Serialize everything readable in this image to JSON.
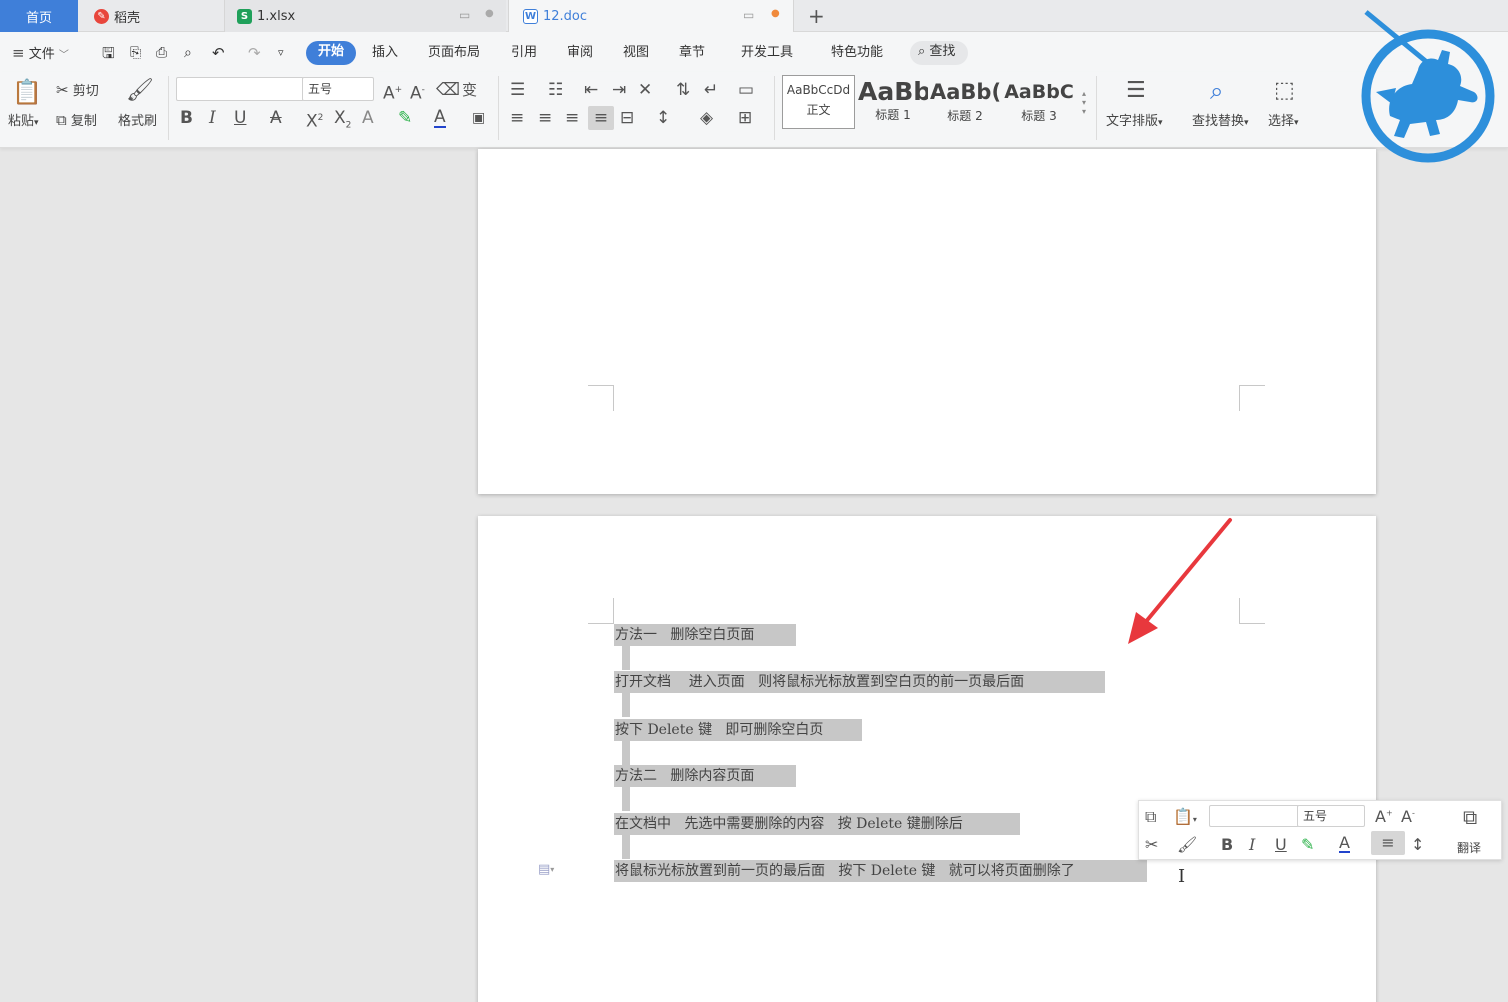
{
  "tabs": [
    {
      "label": "首页",
      "active": true
    },
    {
      "label": "稻壳"
    },
    {
      "label": "1.xlsx"
    },
    {
      "label": "12.doc"
    }
  ],
  "menu": {
    "file": "文件",
    "items": [
      "开始",
      "插入",
      "页面布局",
      "引用",
      "审阅",
      "视图",
      "章节",
      "开发工具",
      "特色功能"
    ],
    "search": "查找"
  },
  "ribbon": {
    "paste": "粘贴",
    "cut": "剪切",
    "copy": "复制",
    "format_painter": "格式刷",
    "font_size": "五号",
    "styles": [
      {
        "preview": "AaBbCcDd",
        "label": "正文"
      },
      {
        "preview": "AaBb",
        "label": "标题 1"
      },
      {
        "preview": "AaBb(",
        "label": "标题 2"
      },
      {
        "preview": "AaBbC",
        "label": "标题 3"
      }
    ],
    "text_layout": "文字排版",
    "find_replace": "查找替换",
    "select": "选择"
  },
  "document": {
    "lines": [
      "方法一   删除空白页面",
      "打开文档    进入页面   则将鼠标光标放置到空白页的前一页最后面",
      "按下 Delete 键   即可删除空白页",
      "方法二   删除内容页面",
      "在文档中   先选中需要删除的内容   按 Delete 键删除后",
      "将鼠标光标放置到前一页的最后面   按下 Delete 键   就可以将页面删除了"
    ]
  },
  "mini_toolbar": {
    "font_size": "五号",
    "translate": "翻译"
  },
  "colors": {
    "accent": "#3f7fd9",
    "selection": "#c7c7c7",
    "arrow": "#e8383d",
    "logo": "#2d8fdb"
  }
}
